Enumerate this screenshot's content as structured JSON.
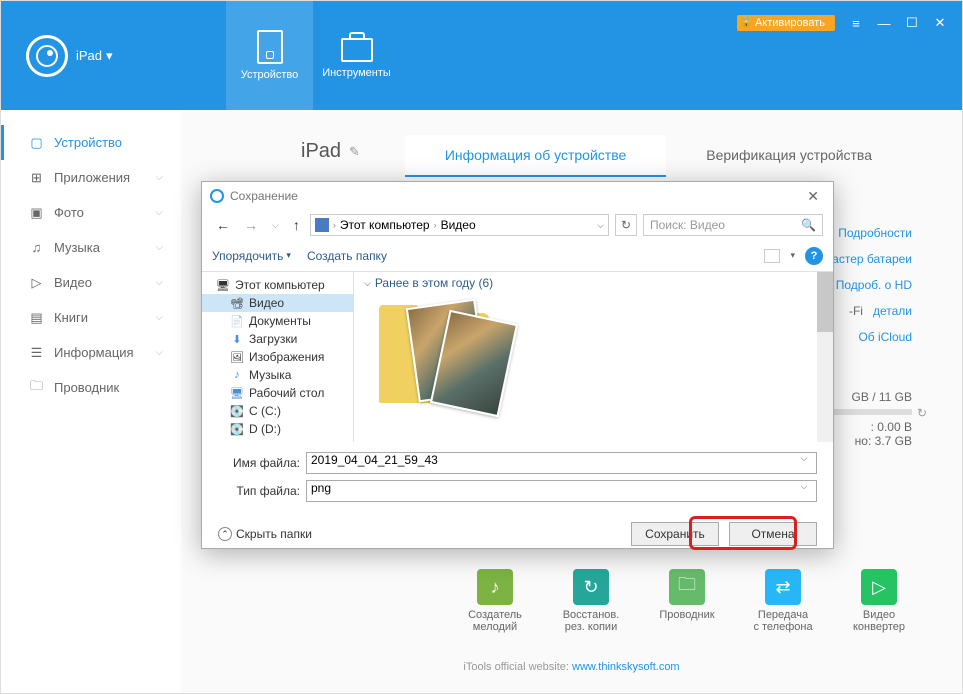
{
  "topbar": {
    "device_name": "iPad",
    "tab_device": "Устройство",
    "tab_tools": "Инструменты",
    "activate": "Активировать"
  },
  "sidebar": {
    "items": [
      {
        "icon": "▢",
        "label": "Устройство"
      },
      {
        "icon": "⊞",
        "label": "Приложения"
      },
      {
        "icon": "▣",
        "label": "Фото"
      },
      {
        "icon": "♫",
        "label": "Музыка"
      },
      {
        "icon": "▷",
        "label": "Видео"
      },
      {
        "icon": "▤",
        "label": "Книги"
      },
      {
        "icon": "☰",
        "label": "Информация"
      },
      {
        "icon": "🗀",
        "label": "Проводник"
      }
    ]
  },
  "main": {
    "device_title": "iPad",
    "tab_info": "Информация об устройстве",
    "tab_verify": "Верификация устройства",
    "links": [
      "Подробности",
      "Мастер батареи",
      "Подроб. о HD",
      "детали",
      "Об iCloud"
    ],
    "wifi_prefix": "-Fi",
    "storage": "GB / 11 GB",
    "val1": ": 0.00 B",
    "val2": "но: 3.7 GB"
  },
  "tools": [
    {
      "color": "#7cb342",
      "label": "Создатель\nмелодий"
    },
    {
      "color": "#26a69a",
      "label": "Восстанов.\nрез. копии"
    },
    {
      "color": "#66bb6a",
      "label": "Проводник"
    },
    {
      "color": "#29b6f6",
      "label": "Передача\nс телефона"
    },
    {
      "color": "#26c363",
      "label": "Видео\nконвертер"
    }
  ],
  "footer": {
    "text": "iTools official website: ",
    "link": "www.thinkskysoft.com"
  },
  "dialog": {
    "title": "Сохранение",
    "breadcrumb": [
      "Этот компьютер",
      "Видео"
    ],
    "search_placeholder": "Поиск: Видео",
    "organize": "Упорядочить",
    "new_folder": "Создать папку",
    "tree": [
      {
        "icon": "🖥",
        "label": "Этот компьютер"
      },
      {
        "icon": "📽",
        "label": "Видео"
      },
      {
        "icon": "📄",
        "label": "Документы"
      },
      {
        "icon": "⬇",
        "label": "Загрузки"
      },
      {
        "icon": "🖼",
        "label": "Изображения"
      },
      {
        "icon": "♪",
        "label": "Музыка"
      },
      {
        "icon": "🖥",
        "label": "Рабочий стол"
      },
      {
        "icon": "💽",
        "label": "C (C:)"
      },
      {
        "icon": "💽",
        "label": "D (D:)"
      }
    ],
    "group_header": "Ранее в этом году (6)",
    "filename_label": "Имя файла:",
    "filename_value": "2019_04_04_21_59_43",
    "filetype_label": "Тип файла:",
    "filetype_value": "png",
    "hide_folders": "Скрыть папки",
    "save": "Сохранить",
    "cancel": "Отмена"
  }
}
